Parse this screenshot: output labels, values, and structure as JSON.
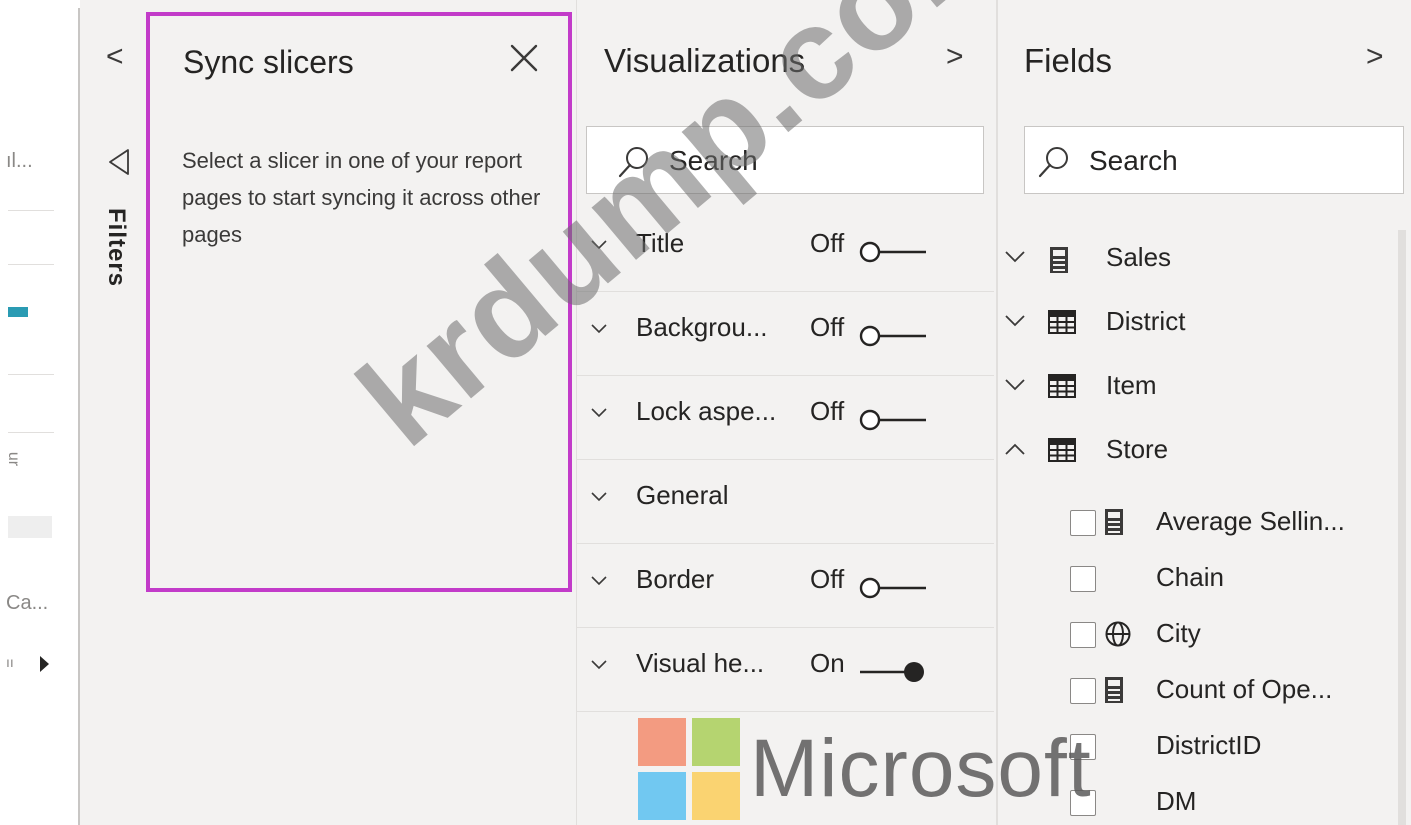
{
  "canvas": {
    "snippets": [
      "ıl...",
      "Ca...",
      "ıı"
    ],
    "rotated_snippet": "ur"
  },
  "filters": {
    "collapse_glyph": "<",
    "label": "Filters"
  },
  "sync_slicers": {
    "title": "Sync slicers",
    "message": "Select a slicer in one of your report pages to start syncing it across other pages"
  },
  "visualizations": {
    "title": "Visualizations",
    "expand_glyph": ">",
    "search_placeholder": "Search",
    "rows": [
      {
        "label": "Title",
        "state": "Off",
        "on": false
      },
      {
        "label": "Backgrou...",
        "state": "Off",
        "on": false
      },
      {
        "label": "Lock aspe...",
        "state": "Off",
        "on": false
      },
      {
        "label": "General",
        "state": "",
        "on": null
      },
      {
        "label": "Border",
        "state": "Off",
        "on": false
      },
      {
        "label": "Visual he...",
        "state": "On",
        "on": true
      }
    ]
  },
  "fields": {
    "title": "Fields",
    "expand_glyph": ">",
    "search_placeholder": "Search",
    "tables": [
      {
        "name": "Sales",
        "expanded": false,
        "icon": "calculator-table-icon"
      },
      {
        "name": "District",
        "expanded": false,
        "icon": "table-icon"
      },
      {
        "name": "Item",
        "expanded": false,
        "icon": "table-icon"
      },
      {
        "name": "Store",
        "expanded": true,
        "icon": "table-icon"
      }
    ],
    "store_fields": [
      {
        "name": "Average Sellin...",
        "icon": "calculator-icon"
      },
      {
        "name": "Chain",
        "icon": ""
      },
      {
        "name": "City",
        "icon": "globe-icon"
      },
      {
        "name": "Count of Ope...",
        "icon": "calculator-icon"
      },
      {
        "name": "DistrictID",
        "icon": ""
      },
      {
        "name": "DM",
        "icon": ""
      }
    ]
  },
  "watermark": {
    "text": "krdump.com",
    "brand": "Microsoft",
    "logo_colors": [
      "#f35325",
      "#81bc06",
      "#05a6f0",
      "#ffba08"
    ]
  },
  "colors": {
    "highlight_border": "#c23bc9",
    "pane_bg": "#f3f2f1",
    "accent_teal": "#2a9bb3"
  }
}
